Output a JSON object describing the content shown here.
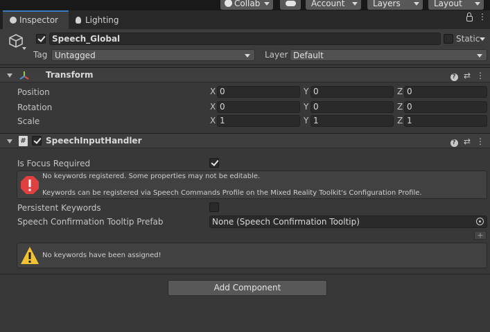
{
  "toolbar": {
    "collab_label": "Collab",
    "account_label": "Account",
    "layers_label": "Layers",
    "layout_label": "Layout"
  },
  "tabs": {
    "inspector": "Inspector",
    "lighting": "Lighting"
  },
  "gameobject": {
    "active": true,
    "name": "Speech_Global",
    "static_label": "Static",
    "static": false,
    "tag_label": "Tag",
    "tag_value": "Untagged",
    "layer_label": "Layer",
    "layer_value": "Default"
  },
  "transform": {
    "title": "Transform",
    "position_label": "Position",
    "rotation_label": "Rotation",
    "scale_label": "Scale",
    "x_label": "X",
    "y_label": "Y",
    "z_label": "Z",
    "position": {
      "x": "0",
      "y": "0",
      "z": "0"
    },
    "rotation": {
      "x": "0",
      "y": "0",
      "z": "0"
    },
    "scale": {
      "x": "1",
      "y": "1",
      "z": "1"
    }
  },
  "speech_handler": {
    "title": "SpeechInputHandler",
    "enabled": true,
    "focus_label": "Is Focus Required",
    "focus_required": true,
    "error_line1": "No keywords registered. Some properties may not be editable.",
    "error_line2": "Keywords can be registered via Speech Commands Profile on the Mixed Reality Toolkit's Configuration Profile.",
    "persistent_label": "Persistent Keywords",
    "persistent": false,
    "tooltip_label": "Speech Confirmation Tooltip Prefab",
    "tooltip_value": "None (Speech Confirmation Tooltip)",
    "plus_label": "+",
    "warning": "No keywords have been assigned!"
  },
  "add_component_label": "Add Component",
  "colors": {
    "background": "#383838",
    "accent": "#3a79bb",
    "error": "#e04040",
    "warning": "#f2c233"
  }
}
